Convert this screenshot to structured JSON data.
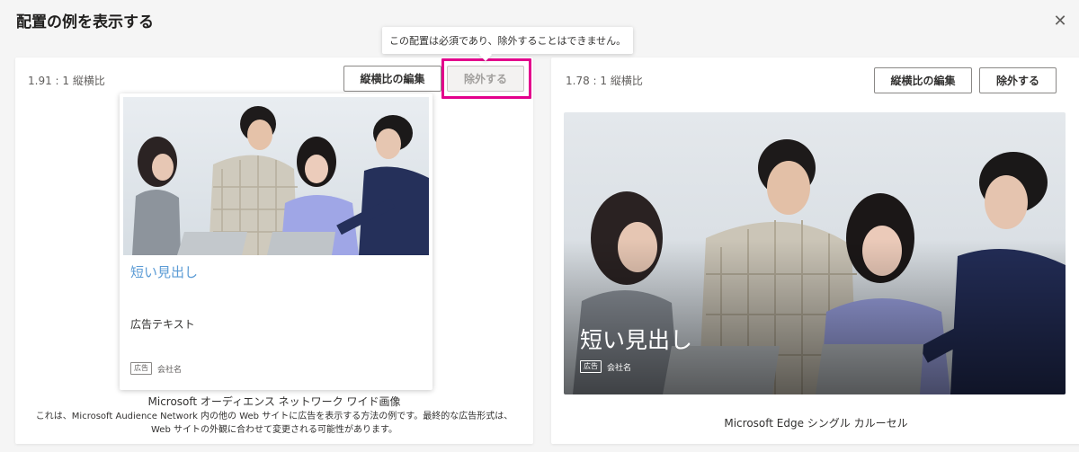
{
  "dialog": {
    "title": "配置の例を表示する",
    "close_glyph": "✕"
  },
  "tooltip": {
    "text": "この配置は必須であり、除外することはできません。"
  },
  "left_card": {
    "ratio_label": "1.91 : 1 縦横比",
    "edit_button": "縦横比の編集",
    "exclude_button": "除外する",
    "exclude_disabled": true,
    "ad": {
      "headline": "短い見出し",
      "text": "広告テキスト",
      "badge": "広告",
      "company": "会社名"
    },
    "caption_title": "Microsoft オーディエンス ネットワーク ワイド画像",
    "caption_desc": "これは、Microsoft Audience Network 内の他の Web サイトに広告を表示する方法の例です。最終的な広告形式は、Web サイトの外観に合わせて変更される可能性があります。"
  },
  "right_card": {
    "ratio_label": "1.78 : 1 縦横比",
    "edit_button": "縦横比の編集",
    "exclude_button": "除外する",
    "ad": {
      "headline": "短い見出し",
      "badge": "広告",
      "company": "会社名"
    },
    "caption": "Microsoft Edge シングル カルーセル"
  },
  "colors": {
    "highlight": "#e3008c",
    "headline_link": "#5b9bd5",
    "background": "#f5f5f5"
  }
}
